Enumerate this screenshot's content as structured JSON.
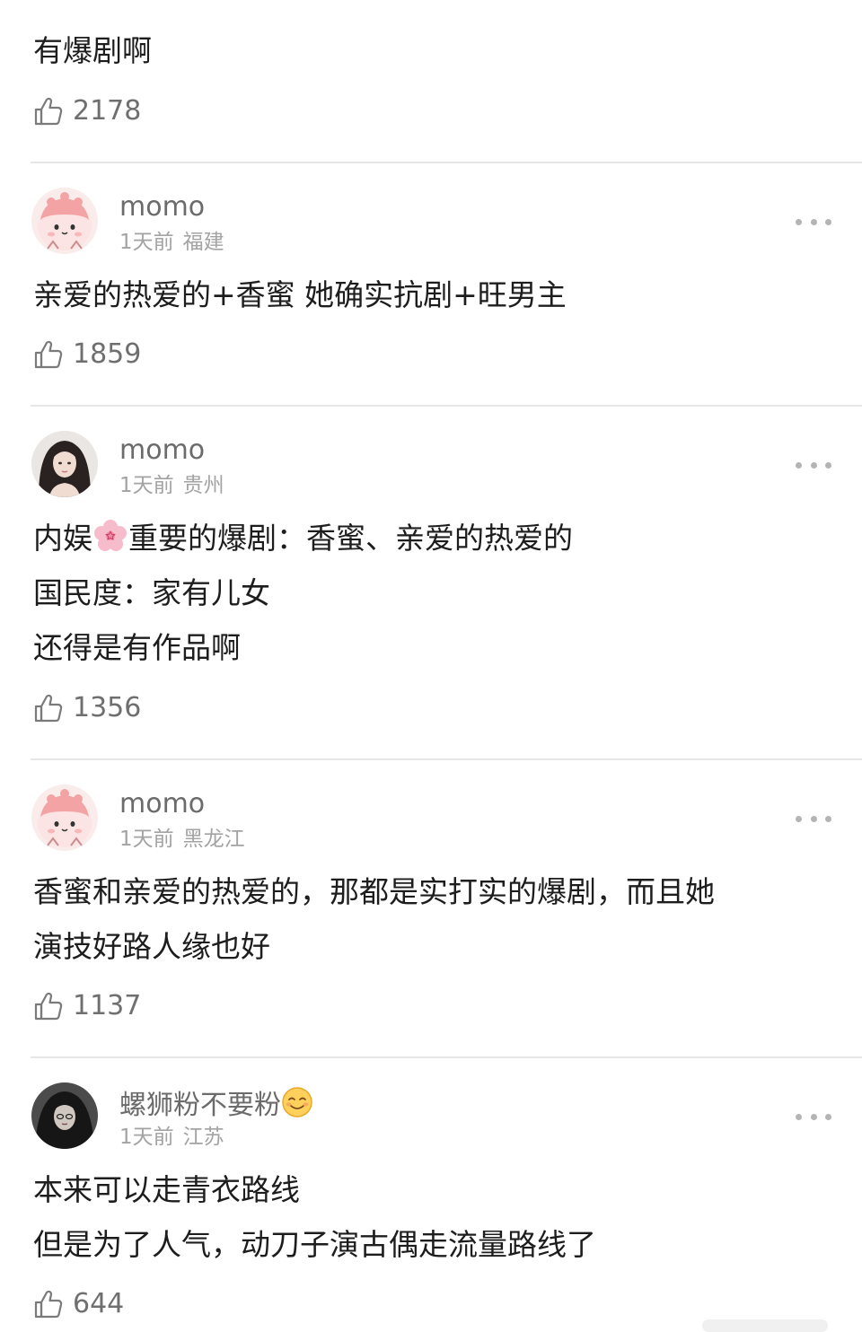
{
  "top_comment": {
    "text": "有爆剧啊",
    "likes": "2178"
  },
  "comments": [
    {
      "username": "momo",
      "time": "1天前",
      "location": "福建",
      "lines": [
        "亲爱的热爱的+香蜜 她确实抗剧+旺男主"
      ],
      "likes": "1859",
      "avatar": "pink-cartoon-avatar"
    },
    {
      "username": "momo",
      "time": "1天前",
      "location": "贵州",
      "lines": [
        "内娱",
        "重要的爆剧：香蜜、亲爱的热爱的",
        "国民度：家有儿女",
        "还得是有作品啊"
      ],
      "inline_emoji": "cherry-blossom-emoji",
      "likes": "1356",
      "avatar": "girl-photo-avatar"
    },
    {
      "username": "momo",
      "time": "1天前",
      "location": "黑龙江",
      "lines": [
        "香蜜和亲爱的热爱的，那都是实打实的爆剧，而且她",
        "演技好路人缘也好"
      ],
      "likes": "1137",
      "avatar": "pink-cartoon-avatar"
    },
    {
      "username": "螺狮粉不要粉",
      "username_emoji": "smiling-face-emoji",
      "time": "1天前",
      "location": "江苏",
      "lines": [
        "本来可以走青衣路线",
        "但是为了人气，动刀子演古偶走流量路线了"
      ],
      "likes": "644",
      "avatar": "dark-photo-avatar"
    }
  ],
  "colors": {
    "text": "#1d1d1d",
    "username": "#6b6b6b",
    "meta": "#a3a3a3",
    "divider": "#e6e6e6"
  }
}
